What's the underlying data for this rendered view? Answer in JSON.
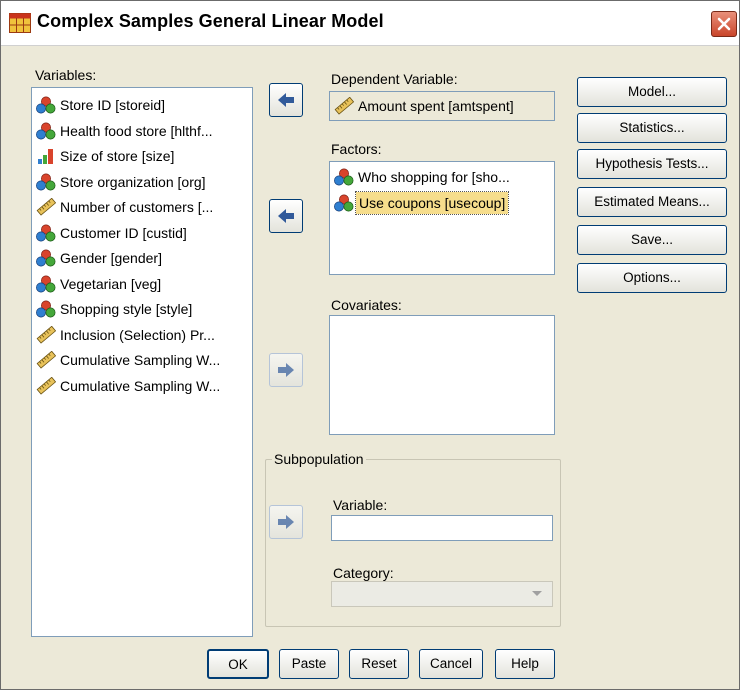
{
  "window": {
    "title": "Complex Samples General Linear Model"
  },
  "variables": {
    "label": "Variables:",
    "items": [
      {
        "label": "Store ID [storeid]",
        "icon": "nominal-icon"
      },
      {
        "label": "Health food store [hlthf...",
        "icon": "nominal-icon"
      },
      {
        "label": "Size of store [size]",
        "icon": "ordinal-icon"
      },
      {
        "label": "Store organization [org]",
        "icon": "nominal-icon"
      },
      {
        "label": "Number of customers [...",
        "icon": "scale-icon"
      },
      {
        "label": "Customer ID [custid]",
        "icon": "nominal-icon"
      },
      {
        "label": "Gender [gender]",
        "icon": "nominal-icon"
      },
      {
        "label": "Vegetarian [veg]",
        "icon": "nominal-icon"
      },
      {
        "label": "Shopping style [style]",
        "icon": "nominal-icon"
      },
      {
        "label": "Inclusion (Selection) Pr...",
        "icon": "scale-icon"
      },
      {
        "label": "Cumulative Sampling W...",
        "icon": "scale-icon"
      },
      {
        "label": "Cumulative Sampling W...",
        "icon": "scale-icon"
      }
    ]
  },
  "dependent": {
    "label": "Dependent Variable:",
    "value": "Amount spent [amtspent]",
    "icon": "scale-icon"
  },
  "factors": {
    "label": "Factors:",
    "items": [
      {
        "label": "Who shopping for [sho...",
        "icon": "nominal-icon",
        "selected": false
      },
      {
        "label": "Use coupons [usecoup]",
        "icon": "nominal-icon",
        "selected": true
      }
    ]
  },
  "covariates": {
    "label": "Covariates:"
  },
  "subpopulation": {
    "legend": "Subpopulation",
    "variable_label": "Variable:",
    "variable_value": "",
    "category_label": "Category:",
    "category_value": ""
  },
  "side_buttons": [
    "Model...",
    "Statistics...",
    "Hypothesis Tests...",
    "Estimated Means...",
    "Save...",
    "Options..."
  ],
  "bottom_buttons": [
    "OK",
    "Paste",
    "Reset",
    "Cancel",
    "Help"
  ],
  "colors": {
    "selection": "#f6dd8c",
    "button_border": "#003c74",
    "list_border": "#7f9db9"
  }
}
